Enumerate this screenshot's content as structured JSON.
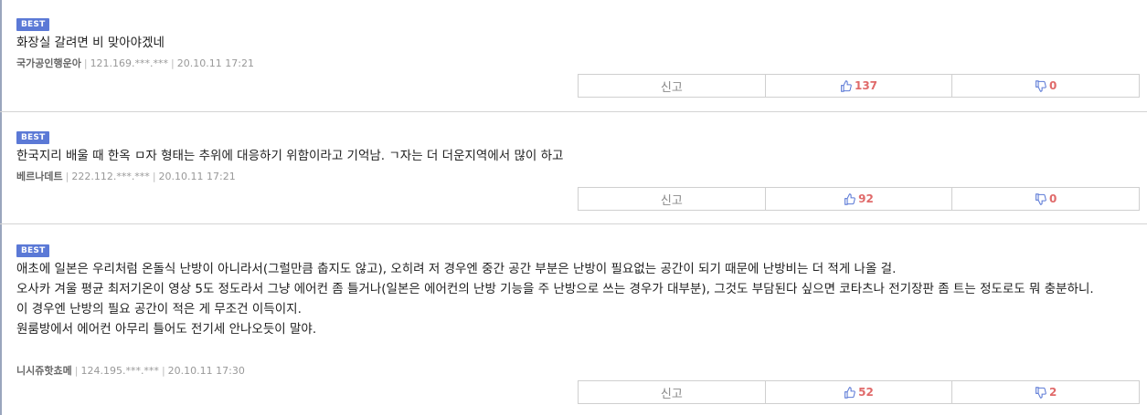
{
  "comments": [
    {
      "badge": "BEST",
      "text": "화장실 갈려면 비 맞아야겠네",
      "nick": "국가공인행운아",
      "ip": "121.169.***.***",
      "date": "20.10.11 17:21",
      "report_label": "신고",
      "likes": "137",
      "dislikes": "0"
    },
    {
      "badge": "BEST",
      "text": "한국지리 배울 때 한옥 ㅁ자 형태는 추위에 대응하기 위함이라고 기억남. ㄱ자는 더 더운지역에서 많이 하고",
      "nick": "베르나데트",
      "ip": "222.112.***.***",
      "date": "20.10.11 17:21",
      "report_label": "신고",
      "likes": "92",
      "dislikes": "0"
    },
    {
      "badge": "BEST",
      "text": "애초에 일본은 우리처럼 온돌식 난방이 아니라서(그럴만큼 춥지도 않고), 오히려 저 경우엔 중간 공간 부분은 난방이 필요없는 공간이 되기 때문에 난방비는 더 적게 나올 걸.\n오사카 겨울 평균 최저기온이 영상 5도 정도라서 그냥 에어컨 좀 틀거나(일본은 에어컨의 난방 기능을 주 난방으로 쓰는 경우가 대부분), 그것도 부담된다 싶으면 코타츠나 전기장판 좀 트는 정도로도 뭐 충분하니.\n이 경우엔 난방의 필요 공간이 적은 게 무조건 이득이지.\n원룸방에서 에어컨 아무리 틀어도 전기세 안나오듯이 말야.",
      "nick": "니시쥬핫쵸메",
      "ip": "124.195.***.***",
      "date": "20.10.11 17:30",
      "report_label": "신고",
      "likes": "52",
      "dislikes": "2"
    }
  ],
  "icons": {
    "like": "thumbs-up-icon",
    "dislike": "thumbs-down-icon"
  },
  "colors": {
    "badge": "#5b79d6",
    "count": "#e06a6a",
    "icon": "#5b79d6"
  }
}
